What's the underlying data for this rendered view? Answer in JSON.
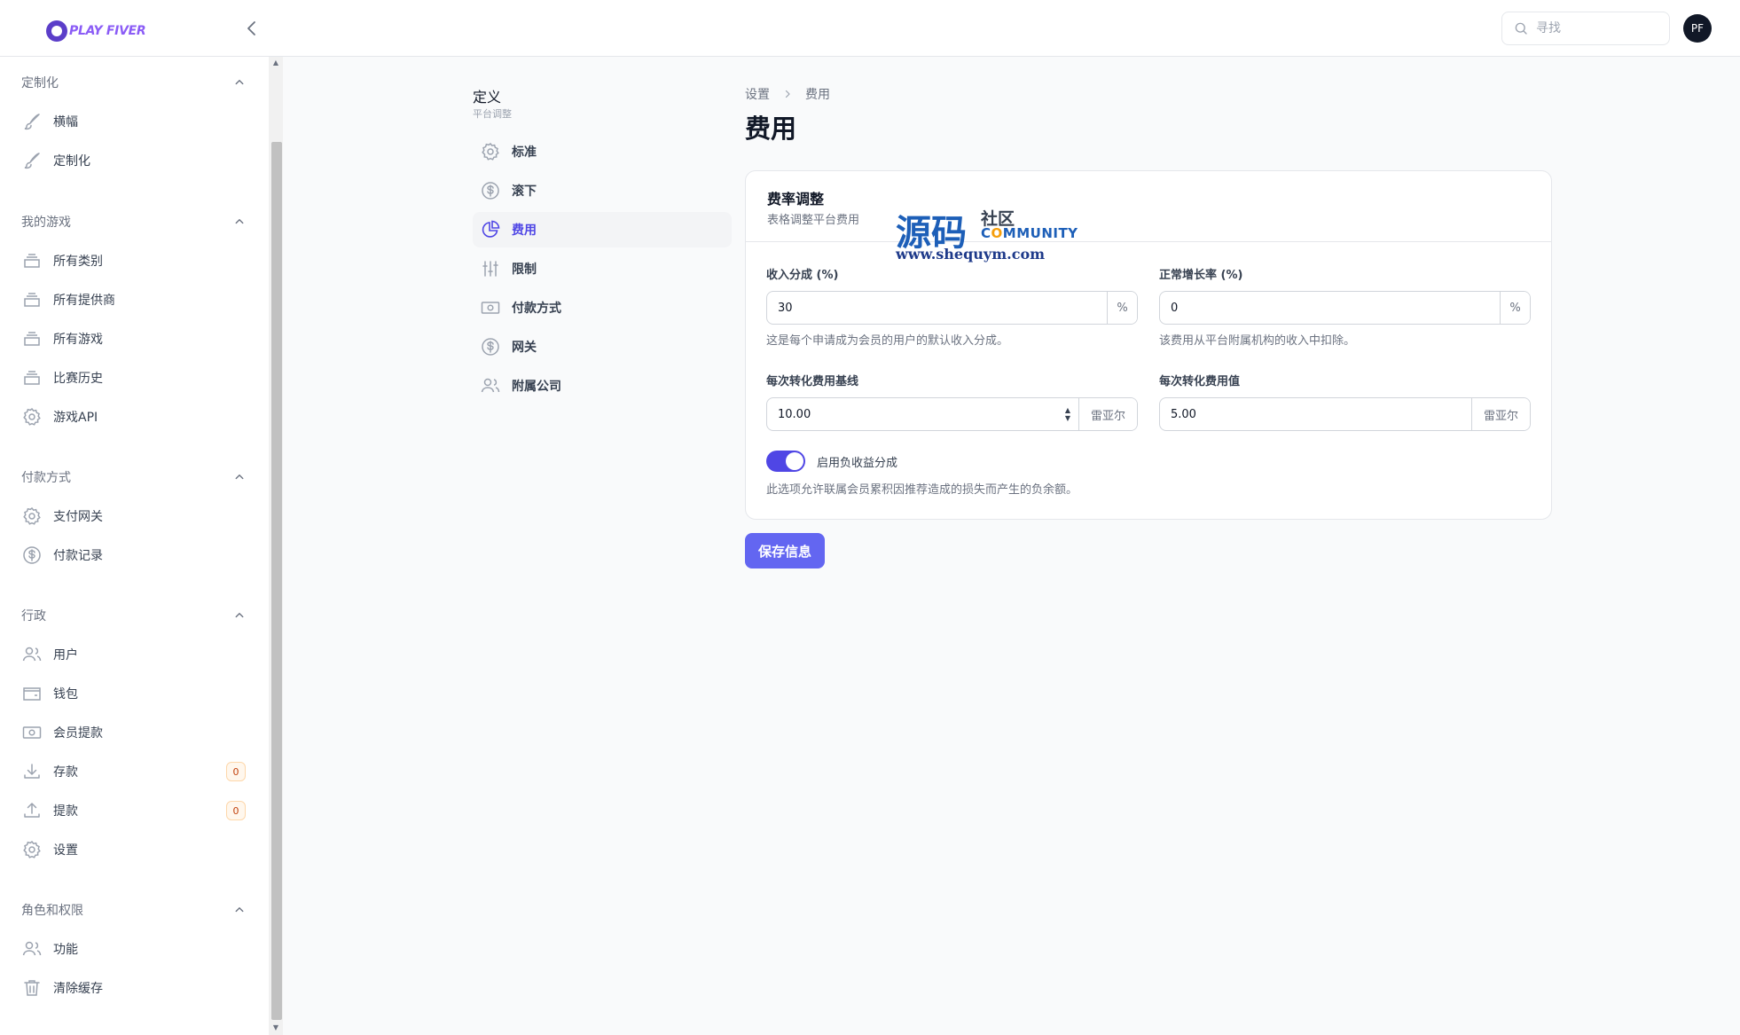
{
  "app": {
    "logo_text": "PLAY FIVER"
  },
  "header": {
    "search_placeholder": "寻找",
    "avatar_initials": "PF"
  },
  "sidebar": {
    "groups": [
      {
        "title": "定制化",
        "items": [
          {
            "label": "横幅",
            "icon": "brush-icon"
          },
          {
            "label": "定制化",
            "icon": "brush-icon"
          }
        ]
      },
      {
        "title": "我的游戏",
        "items": [
          {
            "label": "所有类别",
            "icon": "stack-icon"
          },
          {
            "label": "所有提供商",
            "icon": "stack-icon"
          },
          {
            "label": "所有游戏",
            "icon": "stack-icon"
          },
          {
            "label": "比赛历史",
            "icon": "stack-icon"
          },
          {
            "label": "游戏API",
            "icon": "gear-icon"
          }
        ]
      },
      {
        "title": "付款方式",
        "items": [
          {
            "label": "支付网关",
            "icon": "gear-icon"
          },
          {
            "label": "付款记录",
            "icon": "dollar-icon"
          }
        ]
      },
      {
        "title": "行政",
        "items": [
          {
            "label": "用户",
            "icon": "users-icon"
          },
          {
            "label": "钱包",
            "icon": "wallet-icon"
          },
          {
            "label": "会员提款",
            "icon": "cash-icon"
          },
          {
            "label": "存款",
            "icon": "download-icon",
            "badge": "0"
          },
          {
            "label": "提款",
            "icon": "upload-icon",
            "badge": "0"
          },
          {
            "label": "设置",
            "icon": "gear-icon"
          }
        ]
      },
      {
        "title": "角色和权限",
        "items": [
          {
            "label": "功能",
            "icon": "users-icon"
          },
          {
            "label": "清除缓存",
            "icon": "trash-icon"
          }
        ]
      }
    ]
  },
  "subnav": {
    "title": "定义",
    "subtitle": "平台调整",
    "items": [
      {
        "label": "标准",
        "icon": "gear-icon"
      },
      {
        "label": "滚下",
        "icon": "dollar-icon"
      },
      {
        "label": "费用",
        "icon": "pie-chart-icon",
        "active": true
      },
      {
        "label": "限制",
        "icon": "sliders-icon"
      },
      {
        "label": "付款方式",
        "icon": "cash-icon"
      },
      {
        "label": "网关",
        "icon": "dollar-icon"
      },
      {
        "label": "附属公司",
        "icon": "users-icon"
      }
    ]
  },
  "breadcrumb": {
    "parent": "设置",
    "current": "费用"
  },
  "page": {
    "title": "费用"
  },
  "card": {
    "title": "费率调整",
    "description": "表格调整平台费用",
    "fields": {
      "revenue_share": {
        "label": "收入分成 (%)",
        "value": "30",
        "suffix": "%",
        "help": "这是每个申请成为会员的用户的默认收入分成。"
      },
      "growth_rate": {
        "label": "正常增长率 (%)",
        "value": "0",
        "suffix": "%",
        "help": "该费用从平台附属机构的收入中扣除。"
      },
      "cpa_baseline": {
        "label": "每次转化费用基线",
        "value": "10.00",
        "suffix": "雷亚尔"
      },
      "cpa_value": {
        "label": "每次转化费用值",
        "value": "5.00",
        "suffix": "雷亚尔"
      }
    },
    "toggle": {
      "label": "启用负收益分成",
      "help": "此选项允许联属会员累积因推荐造成的损失而产生的负余额。",
      "enabled": true
    }
  },
  "actions": {
    "save_label": "保存信息"
  },
  "watermark": {
    "big": "源码",
    "cn": "社区",
    "en_before": "C",
    "en_accent": "O",
    "en_after": "MMUNITY",
    "url": "www.shequym.com"
  },
  "colors": {
    "accent": "#4f46e5",
    "button": "#6366f1",
    "logo": "#8b5cf6"
  }
}
